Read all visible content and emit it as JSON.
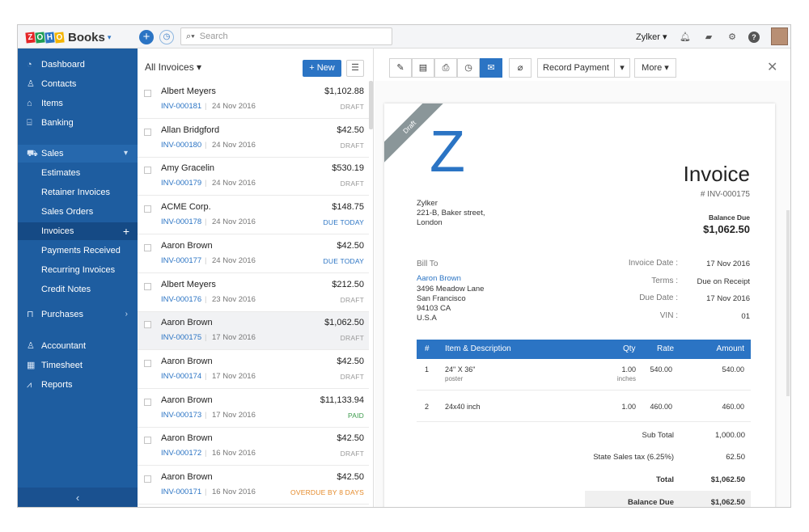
{
  "app": {
    "brand_tiles": [
      "Z",
      "O",
      "H",
      "O"
    ],
    "brand_colors": [
      "#e42527",
      "#1f9d55",
      "#2b74c4",
      "#f4b400"
    ],
    "name": "Books",
    "caret": "▾"
  },
  "topbar": {
    "search_placeholder": "Search",
    "org": "Zylker ▾"
  },
  "sidebar": {
    "items": [
      {
        "label": "Dashboard",
        "icon": "dashboard-icon"
      },
      {
        "label": "Contacts",
        "icon": "contacts-icon"
      },
      {
        "label": "Items",
        "icon": "items-icon"
      },
      {
        "label": "Banking",
        "icon": "bank-icon"
      }
    ],
    "sales": {
      "label": "Sales",
      "icon": "cart-icon"
    },
    "sales_items": [
      "Estimates",
      "Retainer Invoices",
      "Sales Orders",
      "Invoices",
      "Payments Received",
      "Recurring Invoices",
      "Credit Notes"
    ],
    "purchases": {
      "label": "Purchases",
      "icon": "bag-icon"
    },
    "bottom_items": [
      {
        "label": "Accountant",
        "icon": "accountant-icon"
      },
      {
        "label": "Timesheet",
        "icon": "timesheet-icon"
      },
      {
        "label": "Reports",
        "icon": "reports-icon"
      }
    ],
    "collapse": "‹"
  },
  "list": {
    "title": "All Invoices ▾",
    "new_label": "+ New",
    "rows": [
      {
        "name": "Albert Meyers",
        "num": "INV-000181",
        "date": "24 Nov 2016",
        "amount": "$1,102.88",
        "status": "DRAFT",
        "kind": "draft"
      },
      {
        "name": "Allan Bridgford",
        "num": "INV-000180",
        "date": "24 Nov 2016",
        "amount": "$42.50",
        "status": "DRAFT",
        "kind": "draft"
      },
      {
        "name": "Amy Gracelin",
        "num": "INV-000179",
        "date": "24 Nov 2016",
        "amount": "$530.19",
        "status": "DRAFT",
        "kind": "draft"
      },
      {
        "name": "ACME Corp.",
        "num": "INV-000178",
        "date": "24 Nov 2016",
        "amount": "$148.75",
        "status": "DUE TODAY",
        "kind": "due"
      },
      {
        "name": "Aaron Brown",
        "num": "INV-000177",
        "date": "24 Nov 2016",
        "amount": "$42.50",
        "status": "DUE TODAY",
        "kind": "due"
      },
      {
        "name": "Albert Meyers",
        "num": "INV-000176",
        "date": "23 Nov 2016",
        "amount": "$212.50",
        "status": "DRAFT",
        "kind": "draft"
      },
      {
        "name": "Aaron Brown",
        "num": "INV-000175",
        "date": "17 Nov 2016",
        "amount": "$1,062.50",
        "status": "DRAFT",
        "kind": "draft"
      },
      {
        "name": "Aaron Brown",
        "num": "INV-000174",
        "date": "17 Nov 2016",
        "amount": "$42.50",
        "status": "DRAFT",
        "kind": "draft"
      },
      {
        "name": "Aaron Brown",
        "num": "INV-000173",
        "date": "17 Nov 2016",
        "amount": "$11,133.94",
        "status": "PAID",
        "kind": "paid"
      },
      {
        "name": "Aaron Brown",
        "num": "INV-000172",
        "date": "16 Nov 2016",
        "amount": "$42.50",
        "status": "DRAFT",
        "kind": "draft"
      },
      {
        "name": "Aaron Brown",
        "num": "INV-000171",
        "date": "16 Nov 2016",
        "amount": "$42.50",
        "status": "OVERDUE BY 8 DAYS",
        "kind": "over"
      }
    ]
  },
  "detail": {
    "record_payment": "Record Payment",
    "more": "More ▾",
    "ribbon": "Draft",
    "logo_letter": "Z",
    "title": "Invoice",
    "number": "# INV-000175",
    "balance_label": "Balance Due",
    "balance_amount": "$1,062.50",
    "from": [
      "Zylker",
      "221-B, Baker street,",
      "London"
    ],
    "bill_to_label": "Bill To",
    "bill_to_name": "Aaron Brown",
    "bill_to_lines": [
      "3496 Meadow Lane",
      "San Francisco",
      "94103 CA",
      "U.S.A"
    ],
    "meta": [
      {
        "k": "Invoice Date :",
        "v": "17 Nov 2016"
      },
      {
        "k": "Terms :",
        "v": "Due on Receipt"
      },
      {
        "k": "Due Date :",
        "v": "17 Nov 2016"
      },
      {
        "k": "VIN :",
        "v": "01"
      }
    ],
    "table_head": {
      "num": "#",
      "item": "Item & Description",
      "qty": "Qty",
      "rate": "Rate",
      "amount": "Amount"
    },
    "items": [
      {
        "num": "1",
        "item": "24\" X 36\"",
        "desc": "poster",
        "qty": "1.00",
        "unit": "inches",
        "rate": "540.00",
        "amount": "540.00"
      },
      {
        "num": "2",
        "item": "24x40 inch",
        "desc": "",
        "qty": "1.00",
        "unit": "",
        "rate": "460.00",
        "amount": "460.00"
      }
    ],
    "totals": [
      {
        "k": "Sub Total",
        "v": "1,000.00"
      },
      {
        "k": "State Sales tax (6.25%)",
        "v": "62.50"
      },
      {
        "k": "Total",
        "v": "$1,062.50"
      },
      {
        "k": "Balance Due",
        "v": "$1,062.50"
      }
    ]
  }
}
